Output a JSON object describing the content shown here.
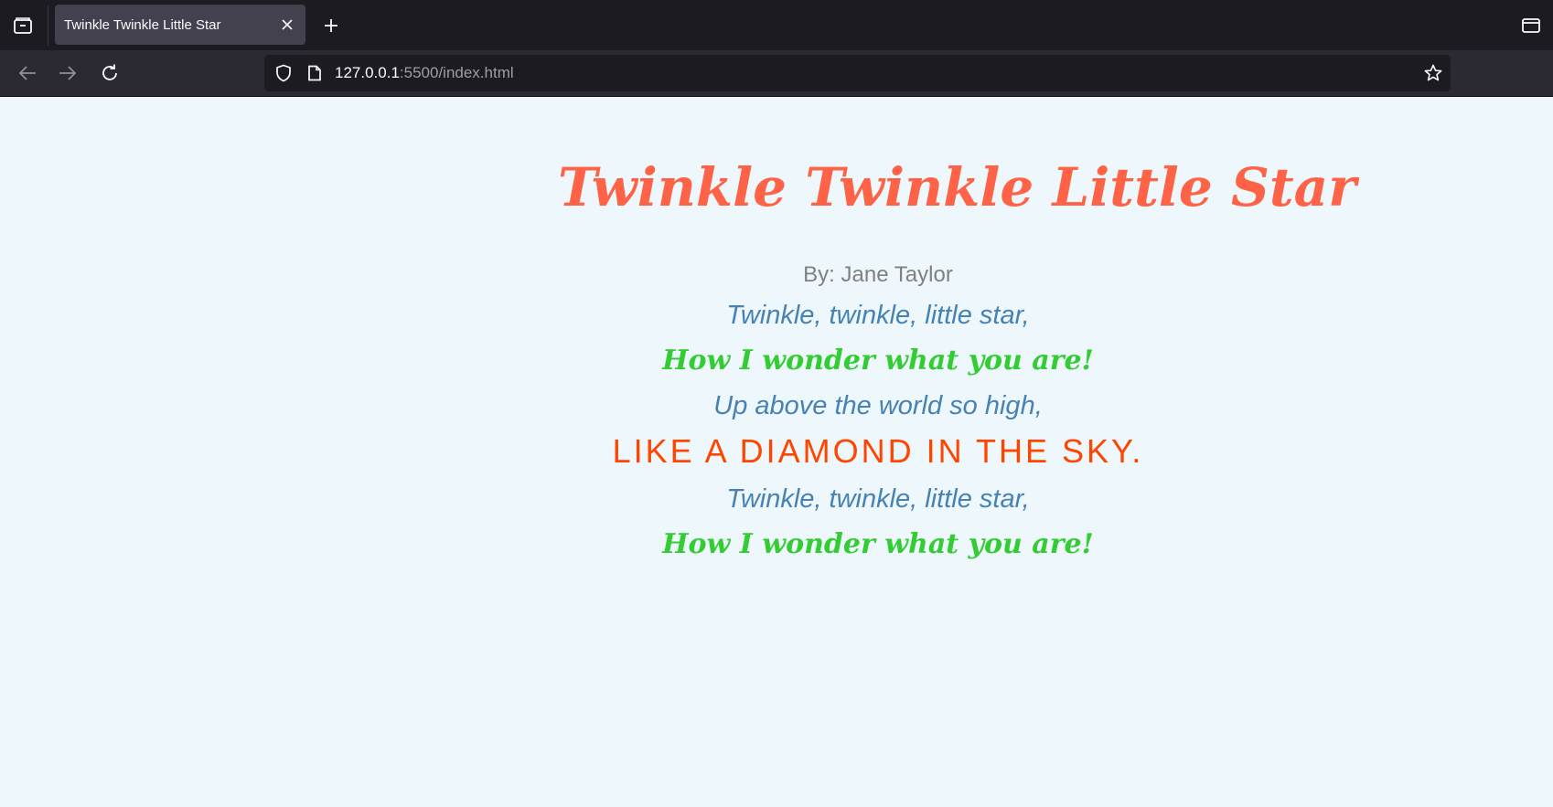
{
  "browser": {
    "tab_title": "Twinkle Twinkle Little Star",
    "url_host": "127.0.0.1",
    "url_rest": ":5500/index.html",
    "icons": {
      "tab_overview": "folder-tab-icon",
      "tab_close": "close-icon",
      "new_tab": "plus-icon",
      "window": "window-icon",
      "back": "arrow-left-icon",
      "forward": "arrow-right-icon",
      "reload": "reload-icon",
      "shield": "shield-icon",
      "page": "page-icon",
      "bookmark": "star-icon"
    }
  },
  "poem": {
    "title": "Twinkle Twinkle Little Star",
    "author": "By: Jane Taylor",
    "lines": [
      "Twinkle, twinkle, little star,",
      "How I wonder what you are!",
      "Up above the world so high,",
      "Like a diamond in the sky.",
      "Twinkle, twinkle, little star,",
      "How I wonder what you are!"
    ]
  },
  "colors": {
    "title": "#ff6347",
    "author": "#808080",
    "line_blue": "#4682b4",
    "line_green": "#32cd32",
    "line_orange": "#ff4500",
    "page_bg": "#eef7fb"
  }
}
